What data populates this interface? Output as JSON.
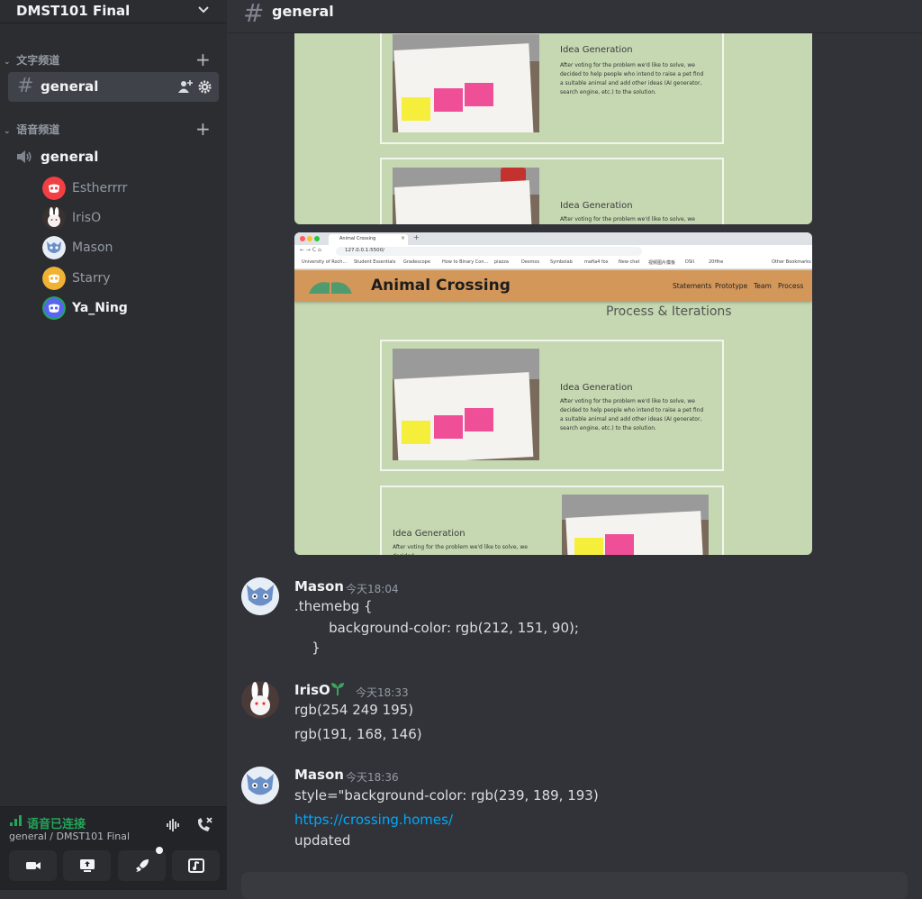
{
  "server": {
    "name": "DMST101 Final"
  },
  "categories": {
    "text": "文字频道",
    "voice": "语音频道"
  },
  "text_channel": {
    "name": "general"
  },
  "voice_channel": {
    "name": "general"
  },
  "voice_users": [
    {
      "name": "Estherrrr",
      "color": "#f23f43"
    },
    {
      "name": "IrisO",
      "color": "#3a3030"
    },
    {
      "name": "Mason",
      "color": "#e8eef5"
    },
    {
      "name": "Starry",
      "color": "#f0b232"
    },
    {
      "name": "Ya_Ning",
      "color": "#5865f2"
    }
  ],
  "topbar": {
    "channel": "general"
  },
  "voice_panel": {
    "status": "语音已连接",
    "channel_path": "general / DMST101 Final"
  },
  "shot1": {
    "card1_title": "Idea Generation",
    "card1_body": "After voting for the problem we'd like to solve, we decided to help people who intend to raise a pet find a suitable animal and add other ideas (AI generator, search engine, etc.) to the solution.",
    "card2_title": "Idea Generation",
    "card2_body": "After voting for the problem we'd like to solve, we decided"
  },
  "shot2": {
    "tab_title": "Animal Crossing",
    "url": "127.0.0.1:5500/",
    "bookmarks": [
      "University of Roch...",
      "Student Essentials",
      "Gradescope",
      "How to Binary Con...",
      "piazza",
      "Desmos",
      "Symbolab",
      "mafia4 fox",
      "New chat",
      "视频图片模板",
      "DSII",
      "20Hhe",
      "Other Bookmarks"
    ],
    "site_title": "Animal Crossing",
    "nav": [
      "Statements",
      "Prototype",
      "Team",
      "Process"
    ],
    "heading": "Process & Iterations",
    "card1_title": "Idea Generation",
    "card1_body": "After voting for the problem we'd like to solve, we decided to help people who intend to raise a pet find a suitable animal and add other ideas (AI generator, search engine, etc.) to the solution.",
    "card2_title": "Idea Generation",
    "card2_body": "After voting for the problem we'd like to solve, we decided"
  },
  "messages": [
    {
      "author": "Mason",
      "time": "今天18:04",
      "lines": [
        ".themebg {",
        "        background-color: rgb(212, 151, 90);",
        "    }"
      ]
    },
    {
      "author": "IrisO",
      "time": "今天18:33",
      "lines": [
        "rgb(254 249 195)",
        "rgb(191, 168, 146)"
      ]
    },
    {
      "author": "Mason",
      "time": "今天18:36",
      "lines": [
        "style=\"background-color: rgb(239, 189, 193)",
        "https://crossing.homes/",
        "updated"
      ]
    }
  ],
  "colors": {
    "online": "#23a55a",
    "link": "#00a8fc",
    "theme_orange": "#d4975a",
    "theme_green": "#c5d8b1"
  }
}
